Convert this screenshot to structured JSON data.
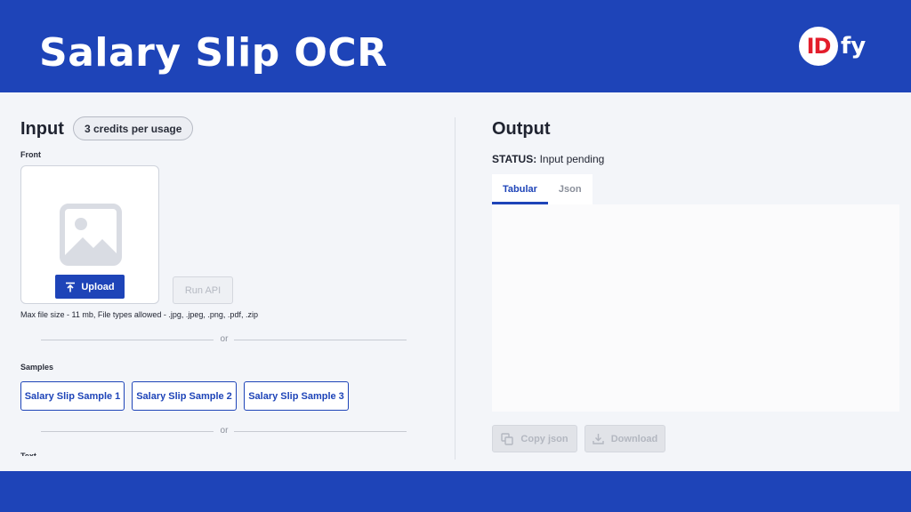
{
  "header": {
    "title": "Salary Slip OCR",
    "logo": {
      "mark": "ID",
      "suffix": "fy",
      "mark_color": "#e31d2b"
    },
    "background": "#1e44b8"
  },
  "input": {
    "title": "Input",
    "credits_badge": "3 credits per usage",
    "front_label": "Front",
    "placeholder_icon": "image-placeholder-icon",
    "upload_label": "Upload",
    "upload_icon": "upload-arrow-icon",
    "run_api_label": "Run API",
    "file_info": "Max file size - 11 mb, File types allowed - .jpg, .jpeg, .png, .pdf, .zip",
    "or_text": "or",
    "samples_label": "Samples",
    "samples": [
      "Salary Slip Sample 1",
      "Salary Slip Sample 2",
      "Salary Slip Sample 3"
    ],
    "next_section_label": "Text"
  },
  "output": {
    "title": "Output",
    "status_label": "STATUS:",
    "status_value": "Input pending",
    "tabs": [
      {
        "label": "Tabular",
        "active": true
      },
      {
        "label": "Json",
        "active": false
      }
    ],
    "copy_json_label": "Copy json",
    "copy_icon": "copy-icon",
    "download_label": "Download",
    "download_icon": "download-icon"
  },
  "colors": {
    "brand_blue": "#1e44b8",
    "page_background": "#f3f5f9",
    "disabled_text": "#b3b7c0"
  }
}
